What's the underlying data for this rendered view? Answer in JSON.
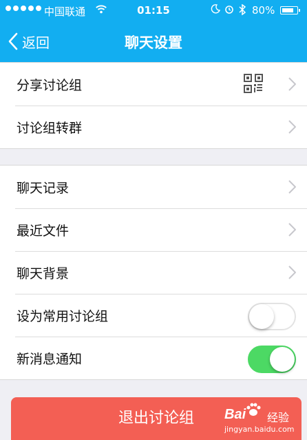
{
  "status_bar": {
    "carrier": "中国联通",
    "time": "01:15",
    "battery": "80%"
  },
  "nav": {
    "back_label": "返回",
    "title": "聊天设置"
  },
  "group1": [
    {
      "label": "分享讨论组",
      "accessory": "qr-code-icon"
    },
    {
      "label": "讨论组转群"
    }
  ],
  "group2": [
    {
      "label": "聊天记录"
    },
    {
      "label": "最近文件"
    },
    {
      "label": "聊天背景"
    },
    {
      "label": "设为常用讨论组",
      "toggle": false
    },
    {
      "label": "新消息通知",
      "toggle": true
    }
  ],
  "exit_button": "退出讨论组",
  "watermark": {
    "brand": "Bai",
    "brand_suffix": "经验",
    "url": "jingyan.baidu.com"
  },
  "colors": {
    "header": "#12aef1",
    "toggle_on": "#4cd964",
    "exit_button": "#f35f54"
  }
}
